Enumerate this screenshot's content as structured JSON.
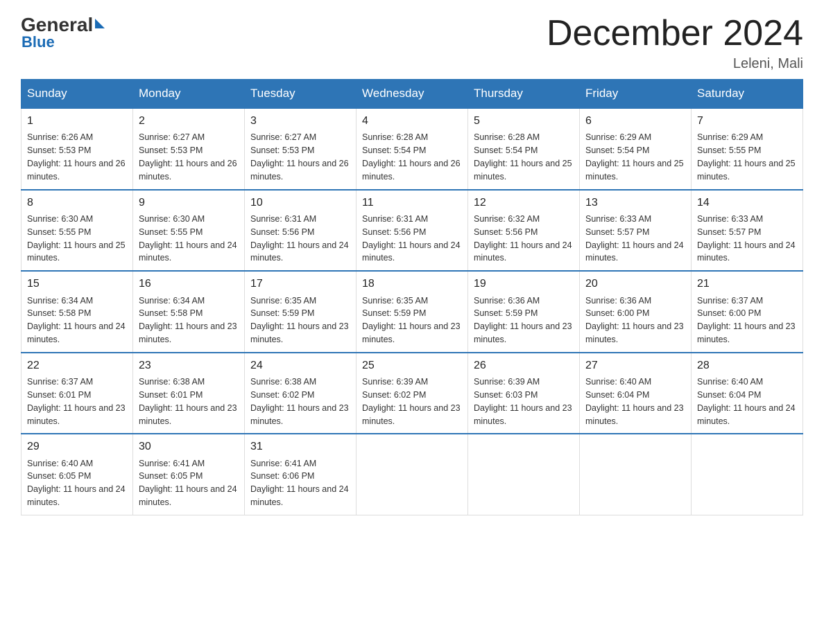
{
  "header": {
    "logo_general": "General",
    "logo_blue": "Blue",
    "month_title": "December 2024",
    "location": "Leleni, Mali"
  },
  "days_of_week": [
    "Sunday",
    "Monday",
    "Tuesday",
    "Wednesday",
    "Thursday",
    "Friday",
    "Saturday"
  ],
  "weeks": [
    [
      {
        "day": "1",
        "sunrise": "6:26 AM",
        "sunset": "5:53 PM",
        "daylight": "11 hours and 26 minutes."
      },
      {
        "day": "2",
        "sunrise": "6:27 AM",
        "sunset": "5:53 PM",
        "daylight": "11 hours and 26 minutes."
      },
      {
        "day": "3",
        "sunrise": "6:27 AM",
        "sunset": "5:53 PM",
        "daylight": "11 hours and 26 minutes."
      },
      {
        "day": "4",
        "sunrise": "6:28 AM",
        "sunset": "5:54 PM",
        "daylight": "11 hours and 26 minutes."
      },
      {
        "day": "5",
        "sunrise": "6:28 AM",
        "sunset": "5:54 PM",
        "daylight": "11 hours and 25 minutes."
      },
      {
        "day": "6",
        "sunrise": "6:29 AM",
        "sunset": "5:54 PM",
        "daylight": "11 hours and 25 minutes."
      },
      {
        "day": "7",
        "sunrise": "6:29 AM",
        "sunset": "5:55 PM",
        "daylight": "11 hours and 25 minutes."
      }
    ],
    [
      {
        "day": "8",
        "sunrise": "6:30 AM",
        "sunset": "5:55 PM",
        "daylight": "11 hours and 25 minutes."
      },
      {
        "day": "9",
        "sunrise": "6:30 AM",
        "sunset": "5:55 PM",
        "daylight": "11 hours and 24 minutes."
      },
      {
        "day": "10",
        "sunrise": "6:31 AM",
        "sunset": "5:56 PM",
        "daylight": "11 hours and 24 minutes."
      },
      {
        "day": "11",
        "sunrise": "6:31 AM",
        "sunset": "5:56 PM",
        "daylight": "11 hours and 24 minutes."
      },
      {
        "day": "12",
        "sunrise": "6:32 AM",
        "sunset": "5:56 PM",
        "daylight": "11 hours and 24 minutes."
      },
      {
        "day": "13",
        "sunrise": "6:33 AM",
        "sunset": "5:57 PM",
        "daylight": "11 hours and 24 minutes."
      },
      {
        "day": "14",
        "sunrise": "6:33 AM",
        "sunset": "5:57 PM",
        "daylight": "11 hours and 24 minutes."
      }
    ],
    [
      {
        "day": "15",
        "sunrise": "6:34 AM",
        "sunset": "5:58 PM",
        "daylight": "11 hours and 24 minutes."
      },
      {
        "day": "16",
        "sunrise": "6:34 AM",
        "sunset": "5:58 PM",
        "daylight": "11 hours and 23 minutes."
      },
      {
        "day": "17",
        "sunrise": "6:35 AM",
        "sunset": "5:59 PM",
        "daylight": "11 hours and 23 minutes."
      },
      {
        "day": "18",
        "sunrise": "6:35 AM",
        "sunset": "5:59 PM",
        "daylight": "11 hours and 23 minutes."
      },
      {
        "day": "19",
        "sunrise": "6:36 AM",
        "sunset": "5:59 PM",
        "daylight": "11 hours and 23 minutes."
      },
      {
        "day": "20",
        "sunrise": "6:36 AM",
        "sunset": "6:00 PM",
        "daylight": "11 hours and 23 minutes."
      },
      {
        "day": "21",
        "sunrise": "6:37 AM",
        "sunset": "6:00 PM",
        "daylight": "11 hours and 23 minutes."
      }
    ],
    [
      {
        "day": "22",
        "sunrise": "6:37 AM",
        "sunset": "6:01 PM",
        "daylight": "11 hours and 23 minutes."
      },
      {
        "day": "23",
        "sunrise": "6:38 AM",
        "sunset": "6:01 PM",
        "daylight": "11 hours and 23 minutes."
      },
      {
        "day": "24",
        "sunrise": "6:38 AM",
        "sunset": "6:02 PM",
        "daylight": "11 hours and 23 minutes."
      },
      {
        "day": "25",
        "sunrise": "6:39 AM",
        "sunset": "6:02 PM",
        "daylight": "11 hours and 23 minutes."
      },
      {
        "day": "26",
        "sunrise": "6:39 AM",
        "sunset": "6:03 PM",
        "daylight": "11 hours and 23 minutes."
      },
      {
        "day": "27",
        "sunrise": "6:40 AM",
        "sunset": "6:04 PM",
        "daylight": "11 hours and 23 minutes."
      },
      {
        "day": "28",
        "sunrise": "6:40 AM",
        "sunset": "6:04 PM",
        "daylight": "11 hours and 24 minutes."
      }
    ],
    [
      {
        "day": "29",
        "sunrise": "6:40 AM",
        "sunset": "6:05 PM",
        "daylight": "11 hours and 24 minutes."
      },
      {
        "day": "30",
        "sunrise": "6:41 AM",
        "sunset": "6:05 PM",
        "daylight": "11 hours and 24 minutes."
      },
      {
        "day": "31",
        "sunrise": "6:41 AM",
        "sunset": "6:06 PM",
        "daylight": "11 hours and 24 minutes."
      },
      null,
      null,
      null,
      null
    ]
  ]
}
